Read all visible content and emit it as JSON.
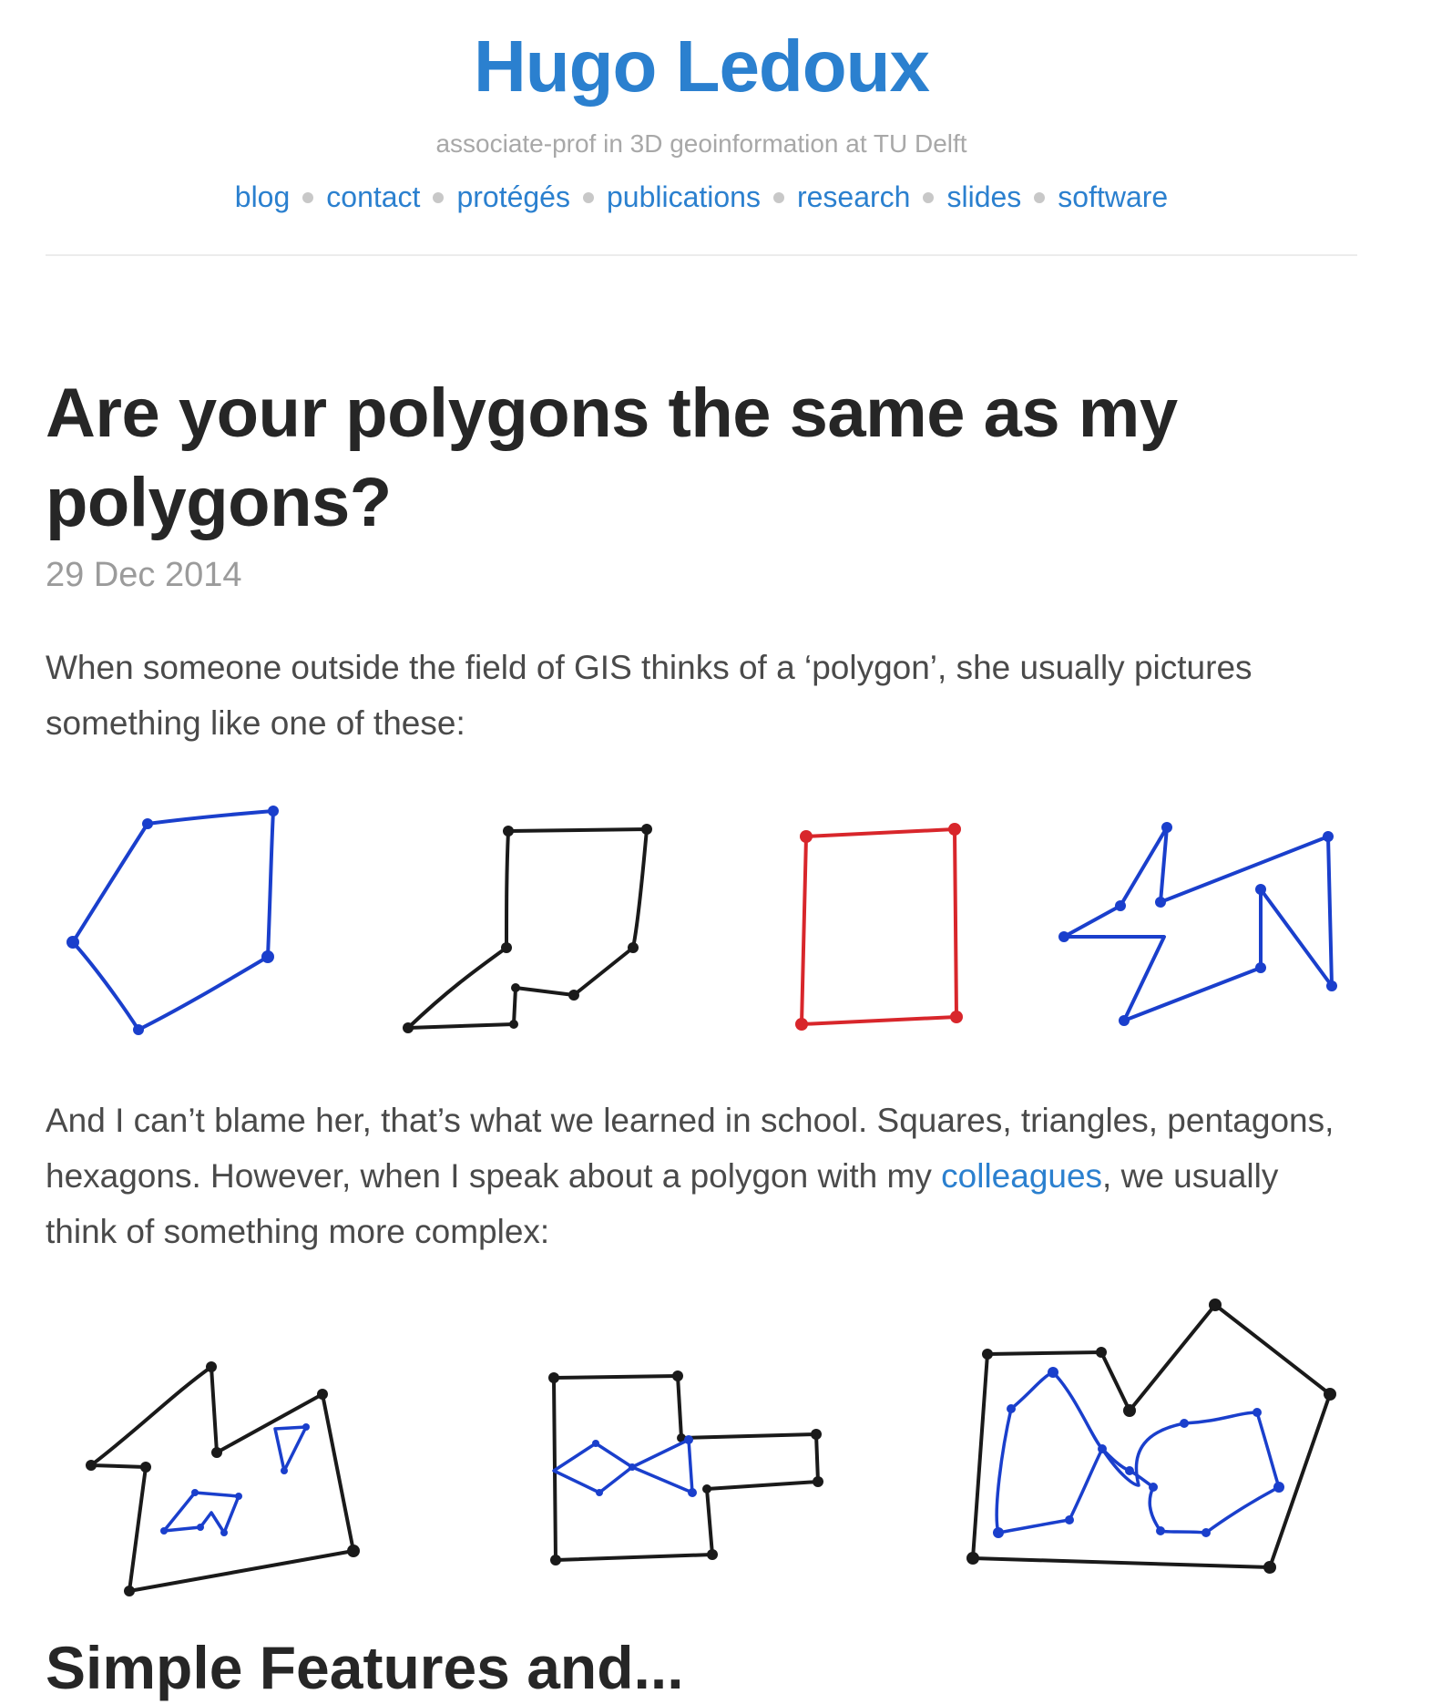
{
  "site": {
    "title": "Hugo Ledoux",
    "tagline": "associate-prof in 3D geoinformation at TU Delft",
    "nav": [
      "blog",
      "contact",
      "protégés",
      "publications",
      "research",
      "slides",
      "software"
    ],
    "accent_color": "#2b80cf"
  },
  "post": {
    "title": "Are your polygons the same as my polygons?",
    "date": "29 Dec 2014",
    "para1": "When someone outside the field of GIS thinks of a ‘polygon’, she usually pictures something like one of these:",
    "para2_before": "And I can’t blame her, that’s what we learned in school. Squares, triangles, pentagons, hexagons. However, when I speak about a polygon with my ",
    "para2_link": "colleagues",
    "para2_after": ", we usually think of something more complex:",
    "next_heading": "Simple Features and..."
  },
  "figures": {
    "simple_polygons": [
      "blue-hexagon",
      "black-boot-shape",
      "red-rectangle",
      "blue-zigzag"
    ],
    "complex_polygons": [
      "house-with-holes",
      "cross-with-bowtie-hole",
      "touching-rings-with-holes"
    ],
    "colors": {
      "blue": "#1a3fcc",
      "black": "#1a1a1a",
      "red": "#d8262b"
    }
  }
}
